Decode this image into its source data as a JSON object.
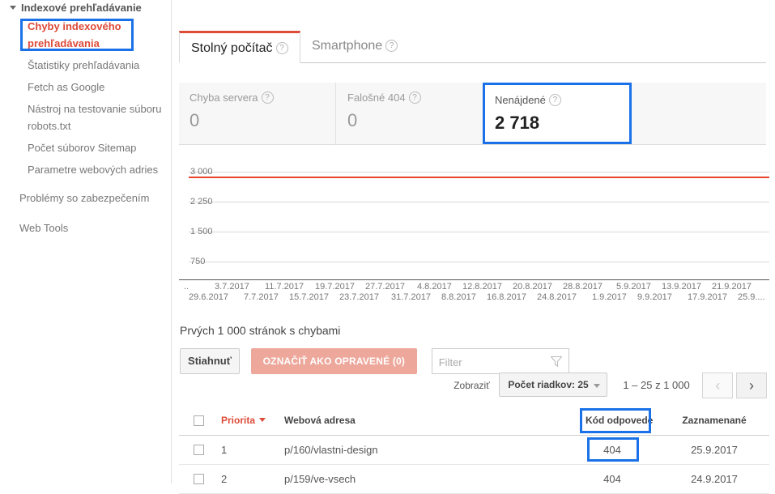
{
  "sidebar": {
    "group_label": "Indexové prehľadávanie",
    "items": [
      {
        "label": "Chyby indexového prehľadávania",
        "selected": true,
        "highlighted": true
      },
      {
        "label": "Štatistiky prehľadávania",
        "selected": false
      },
      {
        "label": "Fetch as Google",
        "selected": false
      },
      {
        "label": "Nástroj na testovanie súboru robots.txt",
        "selected": false
      },
      {
        "label": "Počet súborov Sitemap",
        "selected": false
      },
      {
        "label": "Parametre webových adries",
        "selected": false
      }
    ],
    "top_level_items": [
      {
        "label": "Problémy so zabezpečením"
      },
      {
        "label": "Web Tools"
      }
    ]
  },
  "tabs": [
    {
      "label": "Stolný počítač",
      "active": true,
      "help": "?"
    },
    {
      "label": "Smartphone",
      "active": false,
      "help": "?"
    }
  ],
  "cards": [
    {
      "label": "Chyba servera",
      "value": "0",
      "help": "?",
      "highlighted": false
    },
    {
      "label": "Falošné 404",
      "value": "0",
      "help": "?",
      "highlighted": false
    },
    {
      "label": "Nenájdené",
      "value": "2 718",
      "help": "?",
      "highlighted": true
    }
  ],
  "chart_data": {
    "type": "line",
    "title": "",
    "xlabel": "",
    "ylabel": "",
    "ylim": [
      0,
      3000
    ],
    "grid": true,
    "legend": "none",
    "line_color": "#e8442a",
    "y_ticks": [
      "3 000",
      "2 250",
      "1 500",
      "750"
    ],
    "y_tick_values": [
      3000,
      2250,
      1500,
      750
    ],
    "x_tick_row1": [
      "3.7.2017",
      "11.7.2017",
      "19.7.2017",
      "27.7.2017",
      "4.8.2017",
      "12.8.2017",
      "20.8.2017",
      "28.8.2017",
      "5.9.2017",
      "13.9.2017",
      "21.9.2017"
    ],
    "x_tick_row2": [
      "29.6.2017",
      "7.7.2017",
      "15.7.2017",
      "23.7.2017",
      "31.7.2017",
      "8.8.2017",
      "16.8.2017",
      "24.8.2017",
      "1.9.2017",
      "9.9.2017",
      "17.9.2017",
      "25.9...."
    ],
    "x_leading_ellipsis": "..",
    "series": [
      {
        "name": "Nenájdené",
        "x": [
          "29.6.2017",
          "3.7.2017",
          "7.7.2017",
          "11.7.2017",
          "15.7.2017",
          "19.7.2017",
          "23.7.2017",
          "27.7.2017",
          "31.7.2017",
          "4.8.2017",
          "8.8.2017",
          "12.8.2017",
          "16.8.2017",
          "20.8.2017",
          "24.8.2017",
          "28.8.2017",
          "1.9.2017",
          "5.9.2017",
          "9.9.2017",
          "13.9.2017",
          "17.9.2017",
          "21.9.2017",
          "25.9.2017"
        ],
        "values": [
          2720,
          2720,
          2718,
          2718,
          2716,
          2716,
          2714,
          2714,
          2712,
          2712,
          2714,
          2714,
          2716,
          2716,
          2718,
          2718,
          2718,
          2718,
          2718,
          2718,
          2718,
          2718,
          2718
        ]
      }
    ]
  },
  "table_section": {
    "title": "Prvých 1 000 stránok s chybami",
    "download_label": "Stiahnuť",
    "mark_fixed_label": "OZNAČIŤ AKO OPRAVENÉ (0)",
    "filter_placeholder": "Filter",
    "filter_value": "",
    "show_label": "Zobraziť",
    "rows_select_label": "Počet riadkov: 25",
    "range_label": "1 – 25 z 1 000",
    "prev_label": "‹",
    "next_label": "›",
    "columns": [
      "Priorita",
      "Webová adresa",
      "Kód odpovede",
      "Zaznamenané"
    ],
    "rows": [
      {
        "priority": "1",
        "url": "p/160/vlastni-design",
        "code": "404",
        "detected": "25.9.2017"
      },
      {
        "priority": "2",
        "url": "p/159/ve-vsech",
        "code": "404",
        "detected": "24.9.2017"
      }
    ]
  },
  "colors": {
    "accent_red": "#dd4b39",
    "highlight_blue": "#1b72e8",
    "line_red": "#e8442a",
    "disabled_button": "#eda79b"
  }
}
